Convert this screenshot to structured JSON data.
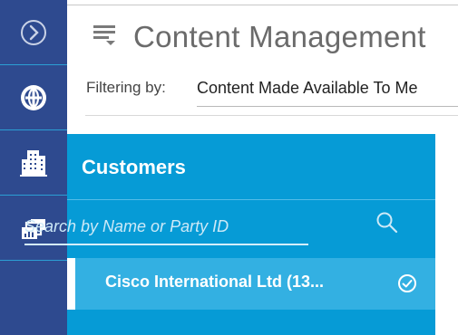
{
  "header": {
    "title": "Content Management",
    "filter_label": "Filtering by:",
    "filter_value": "Content Made Available To Me"
  },
  "rail": {
    "items": [
      {
        "icon": "chevron-right-circle-icon"
      },
      {
        "icon": "globe-icon"
      },
      {
        "icon": "building-icon"
      },
      {
        "icon": "stacked-cards-chart-icon"
      }
    ]
  },
  "customers_panel": {
    "title": "Customers",
    "search_placeholder": "Search by Name or Party ID",
    "results": [
      {
        "label": "Cisco International Ltd (13...",
        "selected": true
      }
    ]
  },
  "colors": {
    "rail": "#2e4a8f",
    "panel": "#069bd6",
    "row_highlight": "#33b0e2"
  }
}
